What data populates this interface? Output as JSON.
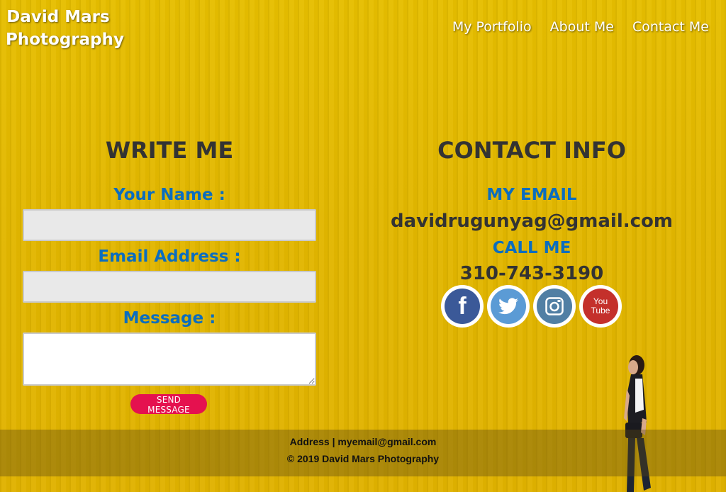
{
  "header": {
    "brand_line1": "David Mars",
    "brand_line2": "Photography",
    "nav": [
      "My Portfolio",
      "About Me",
      "Contact Me"
    ]
  },
  "write_me": {
    "title": "WRITE ME",
    "name_label": "Your Name :",
    "name_value": "",
    "email_label": "Email Address :",
    "email_value": "",
    "message_label": "Message :",
    "message_value": "",
    "send_label": "SEND MESSAGE"
  },
  "contact_info": {
    "title": "CONTACT INFO",
    "email_label": "MY EMAIL",
    "email_value": "davidrugunyag@gmail.com",
    "call_label": "CALL ME",
    "phone_value": "310-743-3190",
    "social": [
      {
        "name": "facebook-icon",
        "glyph": "f",
        "color": "#3b5998"
      },
      {
        "name": "twitter-icon",
        "glyph": "",
        "color": "#5b9bd5"
      },
      {
        "name": "instagram-icon",
        "glyph": "",
        "color": "#517fa4"
      },
      {
        "name": "youtube-icon",
        "glyph": "You Tube",
        "color": "#c4302b"
      }
    ]
  },
  "footer": {
    "line1": "Address | myemail@gmail.com",
    "line2": "© 2019 David Mars Photography"
  },
  "colors": {
    "accent_label": "#0b6dbf",
    "send_button": "#e5114f",
    "background": "#e2b700"
  }
}
